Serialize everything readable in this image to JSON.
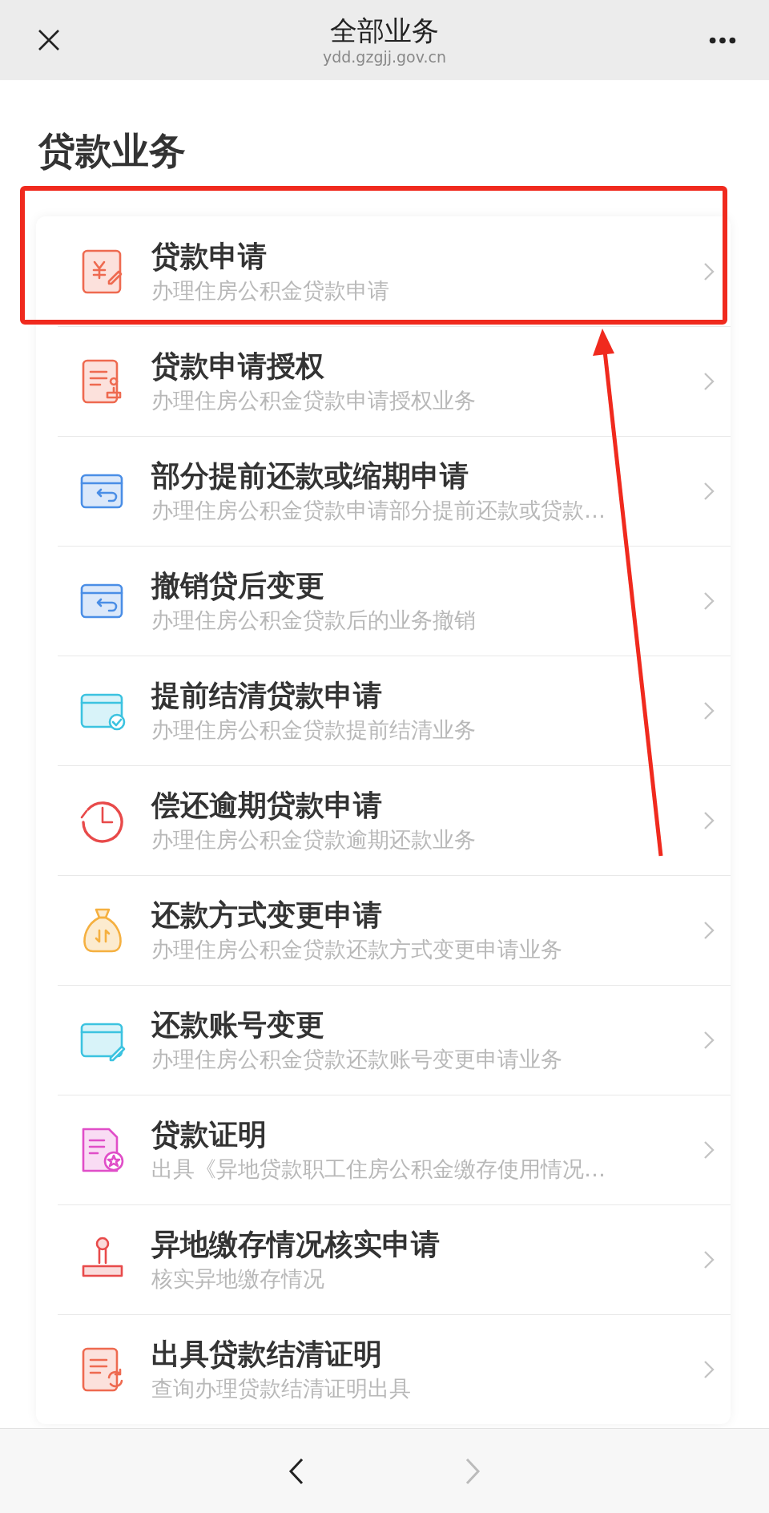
{
  "header": {
    "title": "全部业务",
    "url": "ydd.gzgjj.gov.cn"
  },
  "section": {
    "title": "贷款业务"
  },
  "items": [
    {
      "title": "贷款申请",
      "subtitle": "办理住房公积金贷款申请",
      "kind": "yen-doc",
      "color": "#ee6a50",
      "highlighted": true
    },
    {
      "title": "贷款申请授权",
      "subtitle": "办理住房公积金贷款申请授权业务",
      "kind": "stamp-doc",
      "color": "#ee6a50",
      "highlighted": false
    },
    {
      "title": "部分提前还款或缩期申请",
      "subtitle": "办理住房公积金贷款申请部分提前还款或贷款…",
      "kind": "card-return",
      "color": "#4a8ee6",
      "highlighted": false
    },
    {
      "title": "撤销贷后变更",
      "subtitle": "办理住房公积金贷款后的业务撤销",
      "kind": "card-return",
      "color": "#4a8ee6",
      "highlighted": false
    },
    {
      "title": "提前结清贷款申请",
      "subtitle": "办理住房公积金贷款提前结清业务",
      "kind": "card-check",
      "color": "#3cc3e0",
      "highlighted": false
    },
    {
      "title": "偿还逾期贷款申请",
      "subtitle": "办理住房公积金贷款逾期还款业务",
      "kind": "clock",
      "color": "#e84a4a",
      "highlighted": false
    },
    {
      "title": "还款方式变更申请",
      "subtitle": "办理住房公积金贷款还款方式变更申请业务",
      "kind": "money-bag",
      "color": "#f5b040",
      "highlighted": false
    },
    {
      "title": "还款账号变更",
      "subtitle": "办理住房公积金贷款还款账号变更申请业务",
      "kind": "card-edit",
      "color": "#3cc3e0",
      "highlighted": false
    },
    {
      "title": "贷款证明",
      "subtitle": "出具《异地贷款职工住房公积金缴存使用情况…",
      "kind": "star-doc",
      "color": "#e04ec8",
      "highlighted": false
    },
    {
      "title": "异地缴存情况核实申请",
      "subtitle": "核实异地缴存情况",
      "kind": "stamp",
      "color": "#e84a4a",
      "highlighted": false
    },
    {
      "title": "出具贷款结清证明",
      "subtitle": "查询办理贷款结清证明出具",
      "kind": "refresh-doc",
      "color": "#ee6a50",
      "highlighted": false
    }
  ],
  "nav": {
    "back_disabled": false,
    "forward_disabled": true
  }
}
